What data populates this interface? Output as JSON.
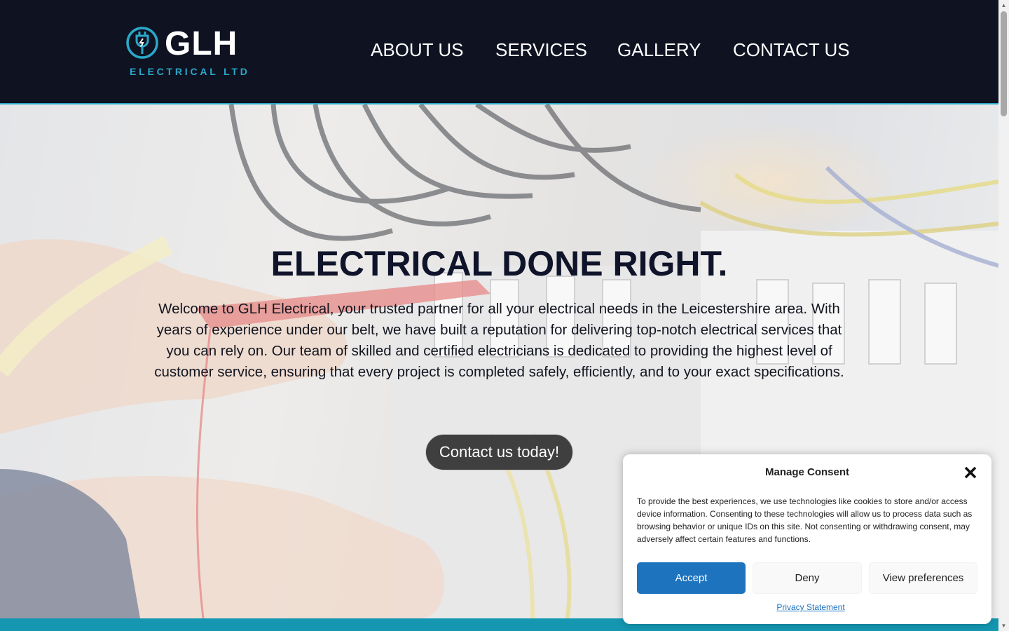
{
  "brand": {
    "name": "GLH",
    "subtitle": "ELECTRICAL LTD",
    "accent_color": "#2aa8c9",
    "header_bg": "#0e1221",
    "logo_icon": "plug-icon"
  },
  "nav": {
    "items": [
      {
        "label": "ABOUT US"
      },
      {
        "label": "SERVICES"
      },
      {
        "label": "GALLERY"
      },
      {
        "label": "CONTACT US"
      }
    ]
  },
  "hero": {
    "title": "ELECTRICAL DONE RIGHT.",
    "text": "Welcome to GLH Electrical, your trusted partner for all your electrical needs in the Leicestershire area. With years of experience under our belt, we have built a reputation for delivering top-notch electrical services that you can rely on. Our team of skilled and certified electricians is dedicated to providing the highest level of customer service, ensuring that every project is completed safely, efficiently, and to your exact specifications.",
    "cta_label": "Contact us today!",
    "band_color": "#1597b2"
  },
  "consent": {
    "title": "Manage Consent",
    "text": "To provide the best experiences, we use technologies like cookies to store and/or access device information. Consenting to these technologies will allow us to process data such as browsing behavior or unique IDs on this site. Not consenting or withdrawing consent, may adversely affect certain features and functions.",
    "accept_label": "Accept",
    "deny_label": "Deny",
    "preferences_label": "View preferences",
    "privacy_label": "Privacy Statement",
    "accept_color": "#1e73be",
    "close_icon": "close-icon"
  }
}
